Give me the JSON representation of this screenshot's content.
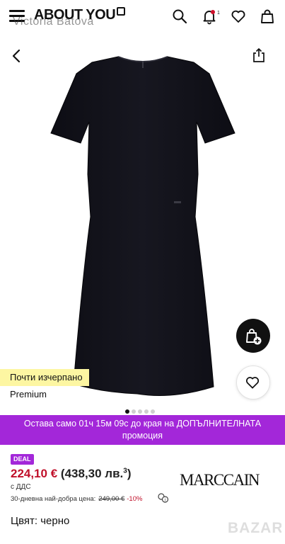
{
  "header": {
    "logo_text": "ABOUT YOU",
    "watermark_text": "Victoria Batova",
    "notification_count": "1"
  },
  "product": {
    "tag_low_stock": "Почти изчерпано",
    "tag_premium": "Premium",
    "image_count": 5,
    "active_image": 1
  },
  "promo": {
    "line1": "Остава само 01ч 15м 09с до края на ДОПЪЛНИТЕЛНАТА",
    "line2": "промоция"
  },
  "pricing": {
    "deal_label": "DEAL",
    "price": "224,10 €",
    "price_bgn": "(438,30 лв.",
    "price_bgn_sup": "3",
    "price_bgn_close": ")",
    "vat_label": "с ДДС",
    "best_price_label": "30-дневна най-добра цена:",
    "best_price_old": "249,00 €",
    "best_price_discount": "-10%"
  },
  "brand": {
    "name": "MARCCAIN"
  },
  "details": {
    "color_label": "Цвят:",
    "color_value": "черно"
  },
  "watermark_corner": {
    "text": "BAZAR"
  },
  "colors": {
    "promo_purple": "#a327d9",
    "price_red": "#c0102a",
    "tag_yellow": "#fdf6a2"
  },
  "icons": [
    "menu-icon",
    "search-icon",
    "bell-icon",
    "heart-icon",
    "bag-icon",
    "back-icon",
    "share-icon",
    "add-to-bag-icon",
    "favorite-icon",
    "info-icon"
  ]
}
